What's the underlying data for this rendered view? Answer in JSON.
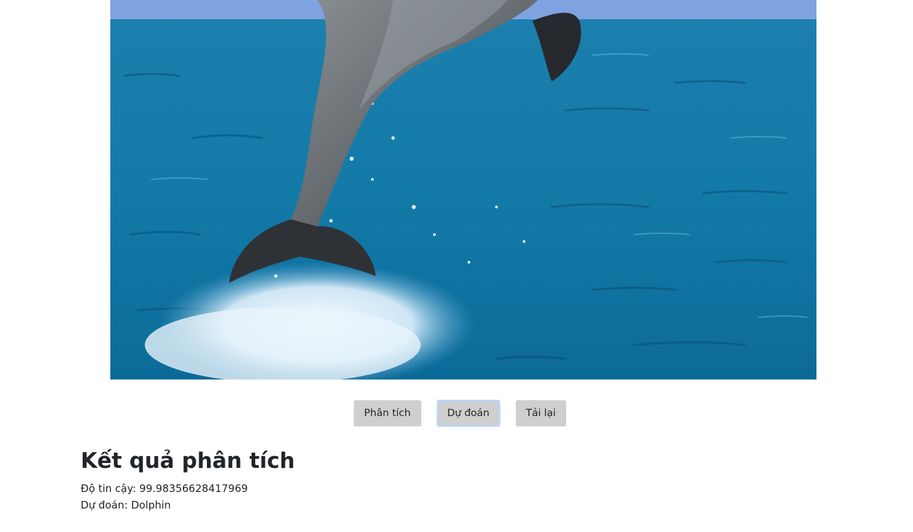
{
  "image": {
    "subject": "dolphin leaping out of the ocean",
    "colors": {
      "sky": "#7ea3e0",
      "sea": "#1f84b2",
      "sea_dark": "#0f5d86",
      "dolphin": "#6e7478",
      "dolphin_dark": "#2d2f33",
      "splash": "#e6f2fb"
    }
  },
  "actions": {
    "analyze_label": "Phân tích",
    "predict_label": "Dự đoán",
    "reload_label": "Tải lại"
  },
  "results": {
    "heading": "Kết quả phân tích",
    "confidence_label": "Độ tin cậy:",
    "confidence_value": "99.98356628417969",
    "prediction_label": "Dự đoán:",
    "prediction_value": "Dolphin"
  }
}
